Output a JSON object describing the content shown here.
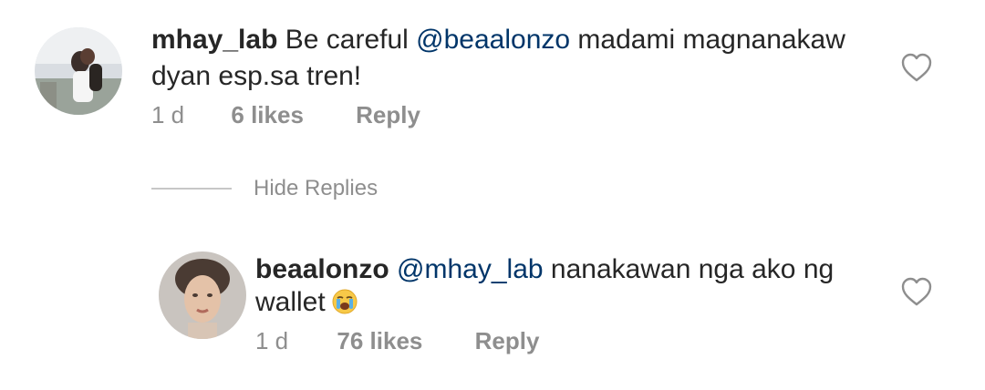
{
  "comments": [
    {
      "username": "mhay_lab",
      "text_pre": "Be careful ",
      "mention": "@beaalonzo",
      "text_post": " madami magnanakaw",
      "text_line2": "dyan esp.sa tren!",
      "time": "1 d",
      "likes": "6 likes",
      "reply_label": "Reply",
      "icons": [
        "avatar-mhay-lab",
        "heart-icon"
      ]
    }
  ],
  "replies_toggle": {
    "label": "Hide Replies"
  },
  "replies": [
    {
      "username": "beaalonzo",
      "mention": "@mhay_lab",
      "text_post": " nanakawan nga ako ng",
      "text_line2": "wallet",
      "emoji": "loudly-crying-face",
      "time": "1 d",
      "likes": "76 likes",
      "reply_label": "Reply",
      "icons": [
        "avatar-beaalonzo",
        "heart-icon"
      ]
    }
  ],
  "colors": {
    "text": "#262626",
    "mention": "#003569",
    "secondary": "#8e8e8e"
  }
}
